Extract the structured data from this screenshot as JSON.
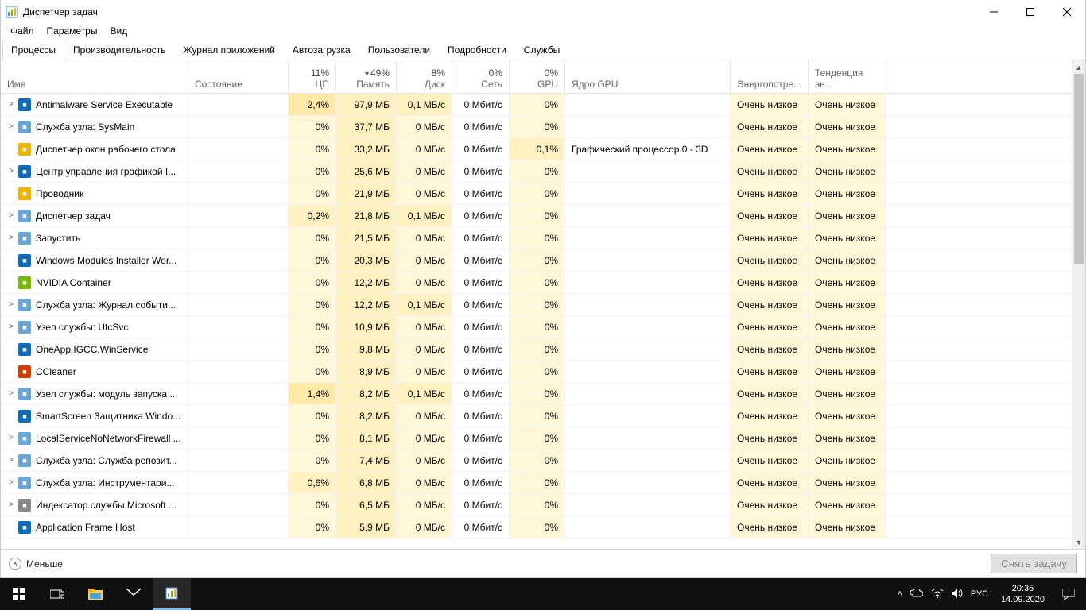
{
  "window": {
    "title": "Диспетчер задач",
    "minimize": "—",
    "maximize": "▭",
    "close": "✕"
  },
  "menu": {
    "file": "Файл",
    "options": "Параметры",
    "view": "Вид"
  },
  "tabs": {
    "processes": "Процессы",
    "performance": "Производительность",
    "app_history": "Журнал приложений",
    "startup": "Автозагрузка",
    "users": "Пользователи",
    "details": "Подробности",
    "services": "Службы"
  },
  "columns": {
    "name": "Имя",
    "state": "Состояние",
    "cpu_pct": "11%",
    "cpu_label": "ЦП",
    "mem_pct": "49%",
    "mem_label": "Память",
    "disk_pct": "8%",
    "disk_label": "Диск",
    "net_pct": "0%",
    "net_label": "Сеть",
    "gpu_pct": "0%",
    "gpu_label": "GPU",
    "gpu_engine": "Ядро GPU",
    "power": "Энергопотре...",
    "power_trend": "Тенденция эн..."
  },
  "rows": [
    {
      "exp": ">",
      "icon": "#0f6cbd",
      "name": "Antimalware Service Executable",
      "cpu": "2,4%",
      "cpu_hl": 2,
      "mem": "97,9 МБ",
      "disk": "0,1 МБ/с",
      "disk_hl": 1,
      "net": "0 Мбит/с",
      "gpu": "0%",
      "gpue": "",
      "pow": "Очень низкое",
      "powt": "Очень низкое"
    },
    {
      "exp": ">",
      "icon": "#6aa6d6",
      "name": "Служба узла: SysMain",
      "cpu": "0%",
      "cpu_hl": 0,
      "mem": "37,7 МБ",
      "disk": "0 МБ/с",
      "disk_hl": 0,
      "net": "0 Мбит/с",
      "gpu": "0%",
      "gpue": "",
      "pow": "Очень низкое",
      "powt": "Очень низкое"
    },
    {
      "exp": "",
      "icon": "#f2b200",
      "name": "Диспетчер окон рабочего стола",
      "cpu": "0%",
      "cpu_hl": 0,
      "mem": "33,2 МБ",
      "disk": "0 МБ/с",
      "disk_hl": 0,
      "net": "0 Мбит/с",
      "gpu": "0,1%",
      "gpu_hl": 1,
      "gpue": "Графический процессор 0 - 3D",
      "pow": "Очень низкое",
      "powt": "Очень низкое"
    },
    {
      "exp": ">",
      "icon": "#0f6cbd",
      "name": "Центр управления графикой I...",
      "cpu": "0%",
      "cpu_hl": 0,
      "mem": "25,6 МБ",
      "disk": "0 МБ/с",
      "disk_hl": 0,
      "net": "0 Мбит/с",
      "gpu": "0%",
      "gpue": "",
      "pow": "Очень низкое",
      "powt": "Очень низкое"
    },
    {
      "exp": "",
      "icon": "#f2b200",
      "name": "Проводник",
      "cpu": "0%",
      "cpu_hl": 0,
      "mem": "21,9 МБ",
      "disk": "0 МБ/с",
      "disk_hl": 0,
      "net": "0 Мбит/с",
      "gpu": "0%",
      "gpue": "",
      "pow": "Очень низкое",
      "powt": "Очень низкое"
    },
    {
      "exp": ">",
      "icon": "#6aa6d6",
      "name": "Диспетчер задач",
      "cpu": "0,2%",
      "cpu_hl": 1,
      "mem": "21,8 МБ",
      "disk": "0,1 МБ/с",
      "disk_hl": 1,
      "net": "0 Мбит/с",
      "gpu": "0%",
      "gpue": "",
      "pow": "Очень низкое",
      "powt": "Очень низкое"
    },
    {
      "exp": ">",
      "icon": "#6aa6d6",
      "name": "Запустить",
      "cpu": "0%",
      "cpu_hl": 0,
      "mem": "21,5 МБ",
      "disk": "0 МБ/с",
      "disk_hl": 0,
      "net": "0 Мбит/с",
      "gpu": "0%",
      "gpue": "",
      "pow": "Очень низкое",
      "powt": "Очень низкое"
    },
    {
      "exp": "",
      "icon": "#0f6cbd",
      "name": "Windows Modules Installer Wor...",
      "cpu": "0%",
      "cpu_hl": 0,
      "mem": "20,3 МБ",
      "disk": "0 МБ/с",
      "disk_hl": 0,
      "net": "0 Мбит/с",
      "gpu": "0%",
      "gpue": "",
      "pow": "Очень низкое",
      "powt": "Очень низкое"
    },
    {
      "exp": "",
      "icon": "#76b900",
      "name": "NVIDIA Container",
      "cpu": "0%",
      "cpu_hl": 0,
      "mem": "12,2 МБ",
      "disk": "0 МБ/с",
      "disk_hl": 0,
      "net": "0 Мбит/с",
      "gpu": "0%",
      "gpue": "",
      "pow": "Очень низкое",
      "powt": "Очень низкое"
    },
    {
      "exp": ">",
      "icon": "#6aa6d6",
      "name": "Служба узла: Журнал событи...",
      "cpu": "0%",
      "cpu_hl": 0,
      "mem": "12,2 МБ",
      "disk": "0,1 МБ/с",
      "disk_hl": 1,
      "net": "0 Мбит/с",
      "gpu": "0%",
      "gpue": "",
      "pow": "Очень низкое",
      "powt": "Очень низкое"
    },
    {
      "exp": ">",
      "icon": "#6aa6d6",
      "name": "Узел службы: UtcSvc",
      "cpu": "0%",
      "cpu_hl": 0,
      "mem": "10,9 МБ",
      "disk": "0 МБ/с",
      "disk_hl": 0,
      "net": "0 Мбит/с",
      "gpu": "0%",
      "gpue": "",
      "pow": "Очень низкое",
      "powt": "Очень низкое"
    },
    {
      "exp": "",
      "icon": "#0f6cbd",
      "name": "OneApp.IGCC.WinService",
      "cpu": "0%",
      "cpu_hl": 0,
      "mem": "9,8 МБ",
      "disk": "0 МБ/с",
      "disk_hl": 0,
      "net": "0 Мбит/с",
      "gpu": "0%",
      "gpue": "",
      "pow": "Очень низкое",
      "powt": "Очень низкое"
    },
    {
      "exp": "",
      "icon": "#d83b01",
      "name": "CCleaner",
      "cpu": "0%",
      "cpu_hl": 0,
      "mem": "8,9 МБ",
      "disk": "0 МБ/с",
      "disk_hl": 0,
      "net": "0 Мбит/с",
      "gpu": "0%",
      "gpue": "",
      "pow": "Очень низкое",
      "powt": "Очень низкое"
    },
    {
      "exp": ">",
      "icon": "#6aa6d6",
      "name": "Узел службы: модуль запуска ...",
      "cpu": "1,4%",
      "cpu_hl": 2,
      "mem": "8,2 МБ",
      "disk": "0,1 МБ/с",
      "disk_hl": 1,
      "net": "0 Мбит/с",
      "gpu": "0%",
      "gpue": "",
      "pow": "Очень низкое",
      "powt": "Очень низкое"
    },
    {
      "exp": "",
      "icon": "#0f6cbd",
      "name": "SmartScreen Защитника Windo...",
      "cpu": "0%",
      "cpu_hl": 0,
      "mem": "8,2 МБ",
      "disk": "0 МБ/с",
      "disk_hl": 0,
      "net": "0 Мбит/с",
      "gpu": "0%",
      "gpue": "",
      "pow": "Очень низкое",
      "powt": "Очень низкое"
    },
    {
      "exp": ">",
      "icon": "#6aa6d6",
      "name": "LocalServiceNoNetworkFirewall ...",
      "cpu": "0%",
      "cpu_hl": 0,
      "mem": "8,1 МБ",
      "disk": "0 МБ/с",
      "disk_hl": 0,
      "net": "0 Мбит/с",
      "gpu": "0%",
      "gpue": "",
      "pow": "Очень низкое",
      "powt": "Очень низкое"
    },
    {
      "exp": ">",
      "icon": "#6aa6d6",
      "name": "Служба узла: Служба репозит...",
      "cpu": "0%",
      "cpu_hl": 0,
      "mem": "7,4 МБ",
      "disk": "0 МБ/с",
      "disk_hl": 0,
      "net": "0 Мбит/с",
      "gpu": "0%",
      "gpue": "",
      "pow": "Очень низкое",
      "powt": "Очень низкое"
    },
    {
      "exp": ">",
      "icon": "#6aa6d6",
      "name": "Служба узла: Инструментари...",
      "cpu": "0,6%",
      "cpu_hl": 1,
      "mem": "6,8 МБ",
      "disk": "0 МБ/с",
      "disk_hl": 0,
      "net": "0 Мбит/с",
      "gpu": "0%",
      "gpue": "",
      "pow": "Очень низкое",
      "powt": "Очень низкое"
    },
    {
      "exp": ">",
      "icon": "#888",
      "name": "Индексатор службы Microsoft ...",
      "cpu": "0%",
      "cpu_hl": 0,
      "mem": "6,5 МБ",
      "disk": "0 МБ/с",
      "disk_hl": 0,
      "net": "0 Мбит/с",
      "gpu": "0%",
      "gpue": "",
      "pow": "Очень низкое",
      "powt": "Очень низкое"
    },
    {
      "exp": "",
      "icon": "#0f6cbd",
      "name": "Application Frame Host",
      "cpu": "0%",
      "cpu_hl": 0,
      "mem": "5,9 МБ",
      "disk": "0 МБ/с",
      "disk_hl": 0,
      "net": "0 Мбит/с",
      "gpu": "0%",
      "gpue": "",
      "pow": "Очень низкое",
      "powt": "Очень низкое"
    }
  ],
  "footer": {
    "less": "Меньше",
    "end_task": "Снять задачу"
  },
  "taskbar": {
    "lang": "РУС",
    "time": "20:35",
    "date": "14.09.2020"
  }
}
